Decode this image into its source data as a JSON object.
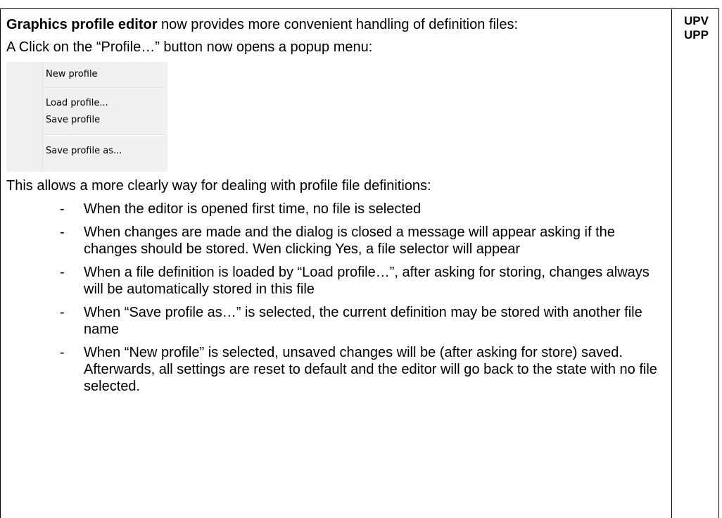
{
  "side_labels": [
    "UPV",
    "UPP"
  ],
  "intro": {
    "bold": "Graphics profile editor",
    "rest": " now provides more convenient handling of definition files:"
  },
  "popup_line": "A Click on the “Profile…” button now opens a popup menu:",
  "menu": {
    "items": [
      "New profile",
      "Load profile...",
      "Save profile",
      "Save profile as..."
    ]
  },
  "lead": "This allows a more clearly way for dealing with profile file definitions:",
  "bullet_glyph": "-",
  "bullets": [
    "When the editor is opened first time, no file is selected",
    "When changes are made and the dialog is closed a message will appear asking if the changes should be stored. Wen clicking Yes, a file selector will appear",
    "When a file definition is loaded by “Load profile…”, after asking for storing, changes always will be automatically stored in this file",
    "When “Save profile as…” is selected, the current definition may be stored with another file name",
    "When “New profile” is selected, unsaved changes will be (after asking for store) saved. Afterwards, all settings are reset to default and the editor will go back to the state with no file selected."
  ]
}
